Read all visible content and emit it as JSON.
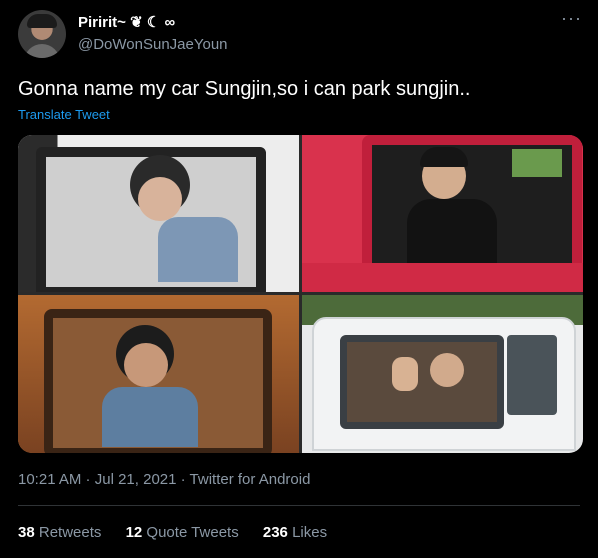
{
  "author": {
    "display_name": "Piririt~ ❦ ☾ ∞",
    "handle": "@DoWonSunJaeYoun"
  },
  "more_icon": "more-dots-icon",
  "tweet": {
    "text": "Gonna name my car Sungjin,so i can park sungjin..",
    "translate_label": "Translate Tweet"
  },
  "photos": [
    {
      "alt": "photo-1"
    },
    {
      "alt": "photo-2"
    },
    {
      "alt": "photo-3"
    },
    {
      "alt": "photo-4"
    }
  ],
  "meta": {
    "time": "10:21 AM",
    "date": "Jul 21, 2021",
    "source": "Twitter for Android",
    "separator": " · "
  },
  "stats": {
    "retweets_count": "38",
    "retweets_label": "Retweets",
    "quotes_count": "12",
    "quotes_label": "Quote Tweets",
    "likes_count": "236",
    "likes_label": "Likes"
  },
  "colors": {
    "background": "#000000",
    "link": "#1d9bf0",
    "muted": "#8b98a5",
    "text": "#ffffff"
  }
}
